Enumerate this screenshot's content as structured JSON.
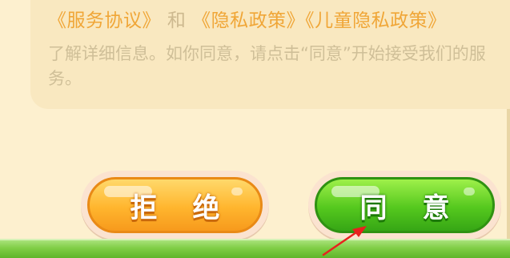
{
  "agreement": {
    "link_service": "《服务协议》",
    "and_text": "和",
    "link_privacy": "《隐私政策》",
    "link_child_privacy": "《儿童隐私政策》",
    "description": "了解详细信息。如你同意，请点击“同意”开始接受我们的服务。"
  },
  "buttons": {
    "reject_label": "拒绝",
    "agree_label": "同意"
  },
  "colors": {
    "background": "#fdf0cf",
    "link": "#f0a637",
    "reject_button": "#ffb52e",
    "agree_button": "#55c81e",
    "arrow": "#e8211e"
  },
  "icons": {
    "annotation": "red-arrow-icon"
  }
}
